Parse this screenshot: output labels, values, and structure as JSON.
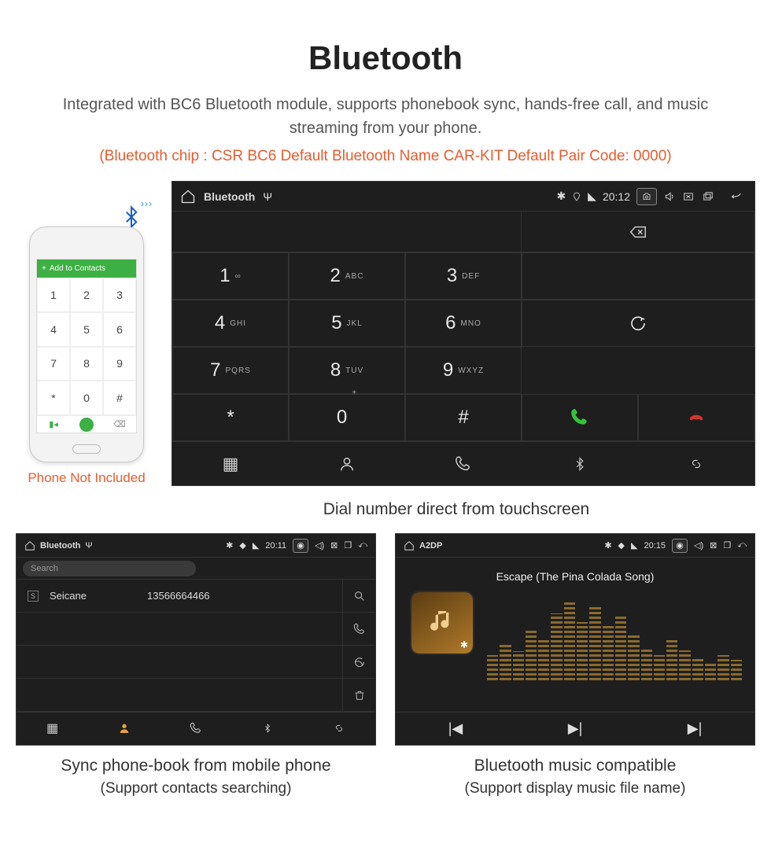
{
  "page": {
    "title": "Bluetooth",
    "subtitle": "Integrated with BC6 Bluetooth module, supports phonebook sync, hands-free call, and music streaming from your phone.",
    "spec": "(Bluetooth chip : CSR BC6    Default Bluetooth Name CAR-KIT    Default Pair Code: 0000)"
  },
  "phone": {
    "header_icon": "+",
    "header_text": "Add to Contacts",
    "note": "Phone Not Included"
  },
  "dialer": {
    "status": {
      "app": "Bluetooth",
      "time": "20:12"
    },
    "keys": [
      {
        "n": "1",
        "s": "∞"
      },
      {
        "n": "2",
        "s": "ABC"
      },
      {
        "n": "3",
        "s": "DEF"
      },
      {
        "n": "4",
        "s": "GHI"
      },
      {
        "n": "5",
        "s": "JKL"
      },
      {
        "n": "6",
        "s": "MNO"
      },
      {
        "n": "7",
        "s": "PQRS"
      },
      {
        "n": "8",
        "s": "TUV"
      },
      {
        "n": "9",
        "s": "WXYZ"
      },
      {
        "n": "*",
        "s": ""
      },
      {
        "n": "0",
        "s": "+"
      },
      {
        "n": "#",
        "s": ""
      }
    ],
    "caption": "Dial number direct from touchscreen"
  },
  "contacts": {
    "status": {
      "app": "Bluetooth",
      "time": "20:11"
    },
    "search_placeholder": "Search",
    "rows": [
      {
        "badge": "S",
        "name": "Seicane",
        "number": "13566664466"
      }
    ],
    "caption": "Sync phone-book from mobile phone",
    "sub_caption": "(Support contacts searching)"
  },
  "music": {
    "status": {
      "app": "A2DP",
      "time": "20:15"
    },
    "track": "Escape (The Pina Colada Song)",
    "caption": "Bluetooth music compatible",
    "sub_caption": "(Support display music file name)"
  }
}
